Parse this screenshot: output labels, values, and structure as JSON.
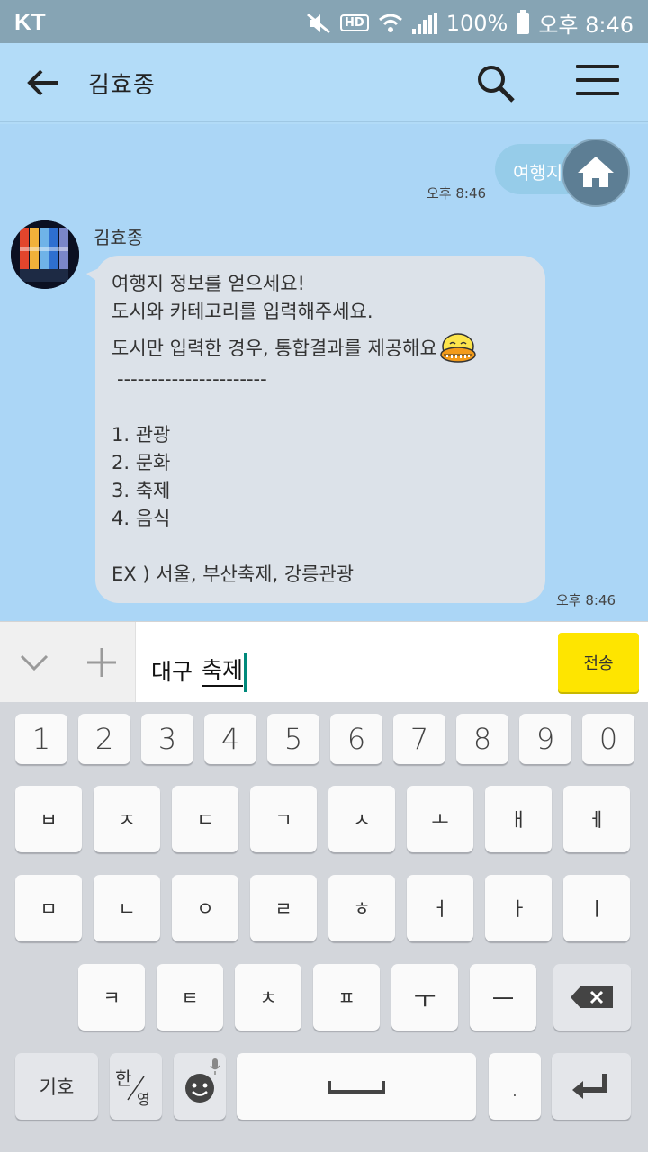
{
  "status_bar": {
    "carrier": "KT",
    "hd_badge": "HD",
    "battery_percent": "100%",
    "time": "오후 8:46",
    "icons": [
      "mute-icon",
      "hd-icon",
      "wifi-icon",
      "signal-icon",
      "battery-icon"
    ]
  },
  "header": {
    "title": "김효종",
    "icons": [
      "back-arrow-icon",
      "search-icon",
      "menu-icon"
    ]
  },
  "chat": {
    "sent": {
      "text": "여행지 정보",
      "time": "오후 8:46"
    },
    "received": {
      "sender": "김효종",
      "time": "오후 8:46",
      "lines": [
        "여행지 정보를 얻으세요!",
        "도시와 카테고리를 입력해주세요.",
        "도시만 입력한 경우, 통합결과를 제공해요",
        "----------------------",
        "1. 관광",
        "2. 문화",
        "3. 축제",
        "4. 음식",
        "EX ) 서울, 부산축제, 강릉관광"
      ]
    }
  },
  "input": {
    "committed_text": "대구",
    "composing_text": "축제",
    "send_label": "전송"
  },
  "keyboard": {
    "row_numbers": [
      "1",
      "2",
      "3",
      "4",
      "5",
      "6",
      "7",
      "8",
      "9",
      "0"
    ],
    "row_1": [
      "ㅂ",
      "ㅈ",
      "ㄷ",
      "ㄱ",
      "ㅅ",
      "ㅗ",
      "ㅐ",
      "ㅔ"
    ],
    "row_2": [
      "ㅁ",
      "ㄴ",
      "ㅇ",
      "ㄹ",
      "ㅎ",
      "ㅓ",
      "ㅏ",
      "ㅣ"
    ],
    "row_3": [
      "ㅋ",
      "ㅌ",
      "ㅊ",
      "ㅍ",
      "ㅜ",
      "ㅡ"
    ],
    "symbols_label": "기호",
    "lang_toggle": {
      "primary": "한",
      "secondary": "영"
    },
    "period_label": "."
  },
  "colors": {
    "status_bar": "#86a4b4",
    "chat_background": "#abd6f6",
    "received_bubble": "#dce2e9",
    "send_button": "#fee500",
    "keyboard_background": "#d3d6db"
  }
}
